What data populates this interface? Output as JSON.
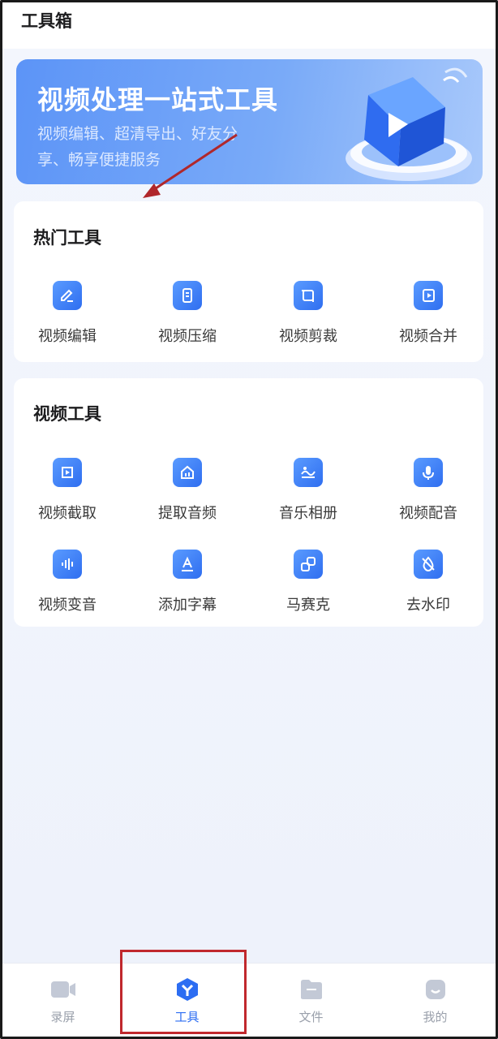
{
  "header": {
    "title": "工具箱"
  },
  "banner": {
    "title": "视频处理一站式工具",
    "subtitle_line1": "视频编辑、超清导出、好友分",
    "subtitle_line2": "享、畅享便捷服务"
  },
  "hot_tools": {
    "title": "热门工具",
    "items": [
      {
        "label": "视频编辑",
        "icon": "edit-icon"
      },
      {
        "label": "视频压缩",
        "icon": "compress-icon"
      },
      {
        "label": "视频剪裁",
        "icon": "crop-icon"
      },
      {
        "label": "视频合并",
        "icon": "merge-icon"
      }
    ]
  },
  "video_tools": {
    "title": "视频工具",
    "items": [
      {
        "label": "视频截取",
        "icon": "trim-icon"
      },
      {
        "label": "提取音频",
        "icon": "extract-audio-icon"
      },
      {
        "label": "音乐相册",
        "icon": "music-album-icon"
      },
      {
        "label": "视频配音",
        "icon": "microphone-icon"
      },
      {
        "label": "视频变音",
        "icon": "voice-change-icon"
      },
      {
        "label": "添加字幕",
        "icon": "subtitle-icon"
      },
      {
        "label": "马赛克",
        "icon": "mosaic-icon"
      },
      {
        "label": "去水印",
        "icon": "remove-watermark-icon"
      }
    ]
  },
  "bottom_nav": {
    "items": [
      {
        "label": "录屏",
        "icon": "record-screen-icon",
        "active": false
      },
      {
        "label": "工具",
        "icon": "tools-icon",
        "active": true
      },
      {
        "label": "文件",
        "icon": "folder-icon",
        "active": false
      },
      {
        "label": "我的",
        "icon": "profile-icon",
        "active": false
      }
    ]
  },
  "colors": {
    "accent": "#2c6df2",
    "banner_start": "#5c94f7",
    "highlight_box": "#c0282d",
    "annotation_arrow": "#b0272b"
  }
}
